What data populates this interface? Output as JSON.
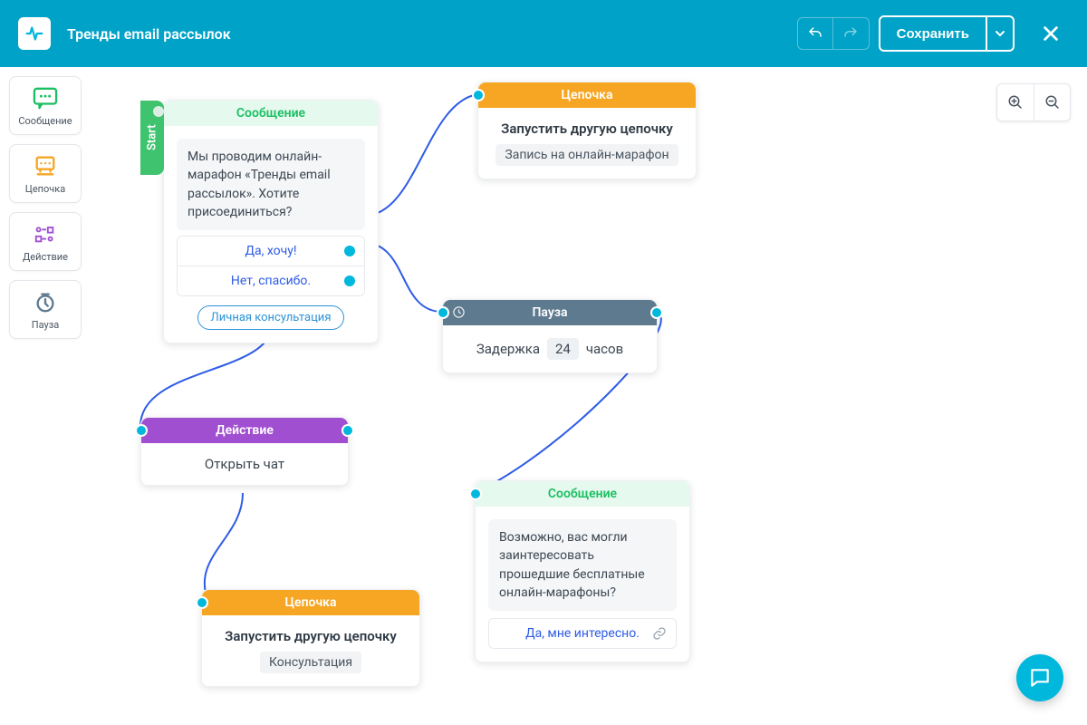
{
  "header": {
    "title": "Тренды email рассылок",
    "save_label": "Сохранить"
  },
  "sidebar": {
    "items": [
      {
        "label": "Сообщение"
      },
      {
        "label": "Цепочка"
      },
      {
        "label": "Действие"
      },
      {
        "label": "Пауза"
      }
    ]
  },
  "nodes": {
    "start_tab": "Start",
    "msg1": {
      "header": "Сообщение",
      "text": "Мы проводим онлайн-марафон «Тренды email рассылок». Хотите присоединиться?",
      "opt1": "Да, хочу!",
      "opt2": "Нет, спасибо.",
      "pill": "Личная консультация"
    },
    "chain1": {
      "header": "Цепочка",
      "title": "Запустить другую цепочку",
      "chip": "Запись на онлайн-марафон"
    },
    "pause": {
      "header": "Пауза",
      "pre": "Задержка",
      "val": "24",
      "post": "часов"
    },
    "action": {
      "header": "Действие",
      "title": "Открыть чат"
    },
    "chain2": {
      "header": "Цепочка",
      "title": "Запустить другую цепочку",
      "chip": "Консультация"
    },
    "msg2": {
      "header": "Сообщение",
      "text": "Возможно, вас могли заинтересовать прошедшие бесплатные онлайн-марафоны?",
      "opt1": "Да, мне интересно."
    }
  }
}
